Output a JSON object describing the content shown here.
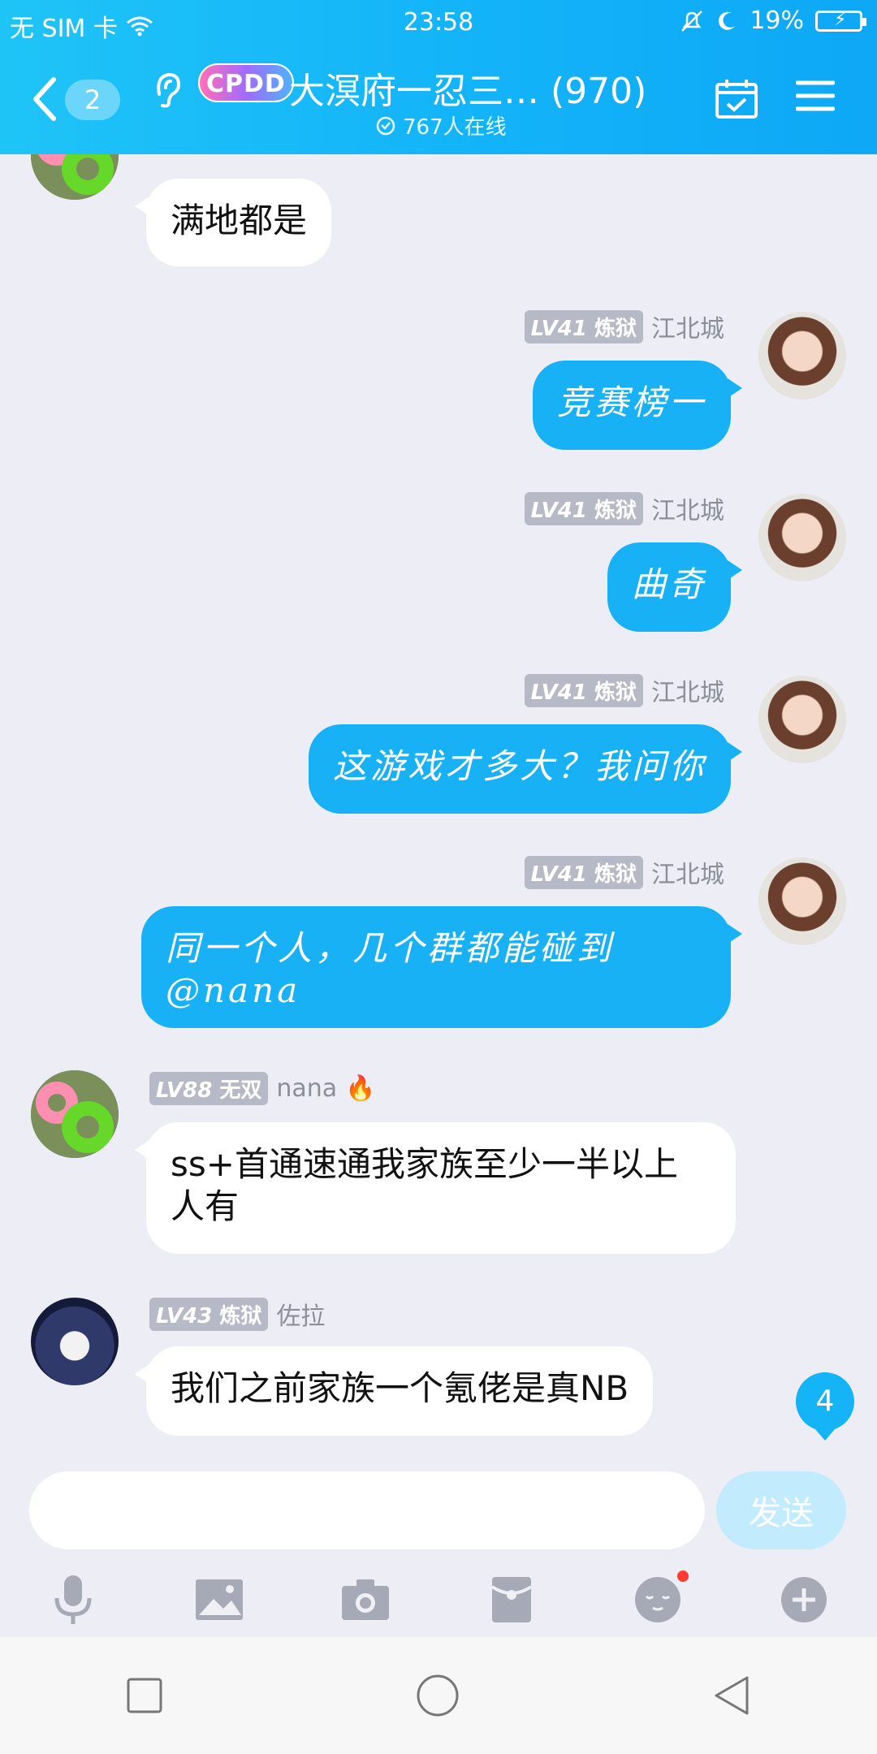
{
  "status": {
    "carrier": "无 SIM 卡",
    "time": "23:58",
    "battery": "19%"
  },
  "header": {
    "back_count": "2",
    "cpdd_badge": "CPDD",
    "title": "大溟府一忍三… (970)",
    "online": "767人在线"
  },
  "messages": [
    {
      "side": "left",
      "text": "满地都是"
    },
    {
      "side": "right",
      "level": "LV41",
      "tag": "炼狱",
      "name": "江北城",
      "text": "竞赛榜一"
    },
    {
      "side": "right",
      "level": "LV41",
      "tag": "炼狱",
      "name": "江北城",
      "text": "曲奇"
    },
    {
      "side": "right",
      "level": "LV41",
      "tag": "炼狱",
      "name": "江北城",
      "text": "这游戏才多大？我问你"
    },
    {
      "side": "right",
      "level": "LV41",
      "tag": "炼狱",
      "name": "江北城",
      "text_line1": "同一个人，几个群都能碰到",
      "text_line2": "@nana"
    },
    {
      "side": "left",
      "level": "LV88",
      "tag": "无双",
      "name": "nana",
      "text_line1": "ss+首通速通我家族至少一半以上",
      "text_line2": "人有"
    },
    {
      "side": "left",
      "level": "LV43",
      "tag": "炼狱",
      "name": "佐拉",
      "text": "我们之前家族一个氪佬是真NB"
    }
  ],
  "unread_count": "4",
  "input": {
    "placeholder": "",
    "send_label": "发送"
  },
  "toolbar": [
    "mic-icon",
    "image-icon",
    "camera-icon",
    "red-packet-icon",
    "emoji-icon",
    "plus-icon"
  ],
  "colors": {
    "accent": "#19b1f5",
    "header_start": "#1fc4f7",
    "bg": "#edeef5"
  }
}
